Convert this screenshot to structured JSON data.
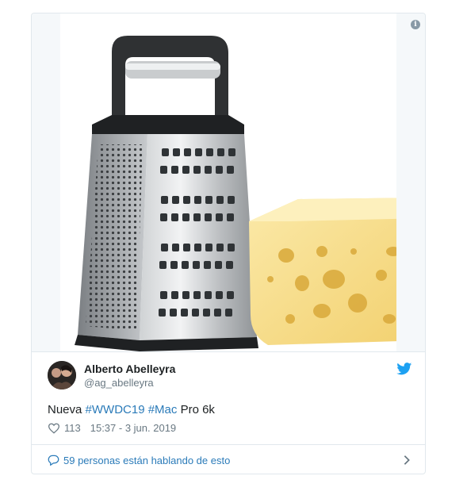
{
  "tweet": {
    "author_name": "Alberto Abelleyra",
    "author_handle": "@ag_abelleyra",
    "text_prefix": "Nueva ",
    "hashtag_1": "#WWDC19",
    "hashtag_2": "#Mac",
    "text_suffix": " Pro 6k",
    "likes": "113",
    "timestamp": "15:37 - 3 jun. 2019",
    "conversation": "59 personas están hablando de esto"
  },
  "icons": {
    "info": "info-icon",
    "brand": "twitter-bird-icon",
    "like": "heart-icon",
    "reply": "speech-bubble-icon",
    "more": "chevron-right-icon"
  },
  "colors": {
    "link": "#2b7bb9",
    "secondary": "#697882",
    "border": "#e1e8ed",
    "bird": "#1da1f2"
  }
}
